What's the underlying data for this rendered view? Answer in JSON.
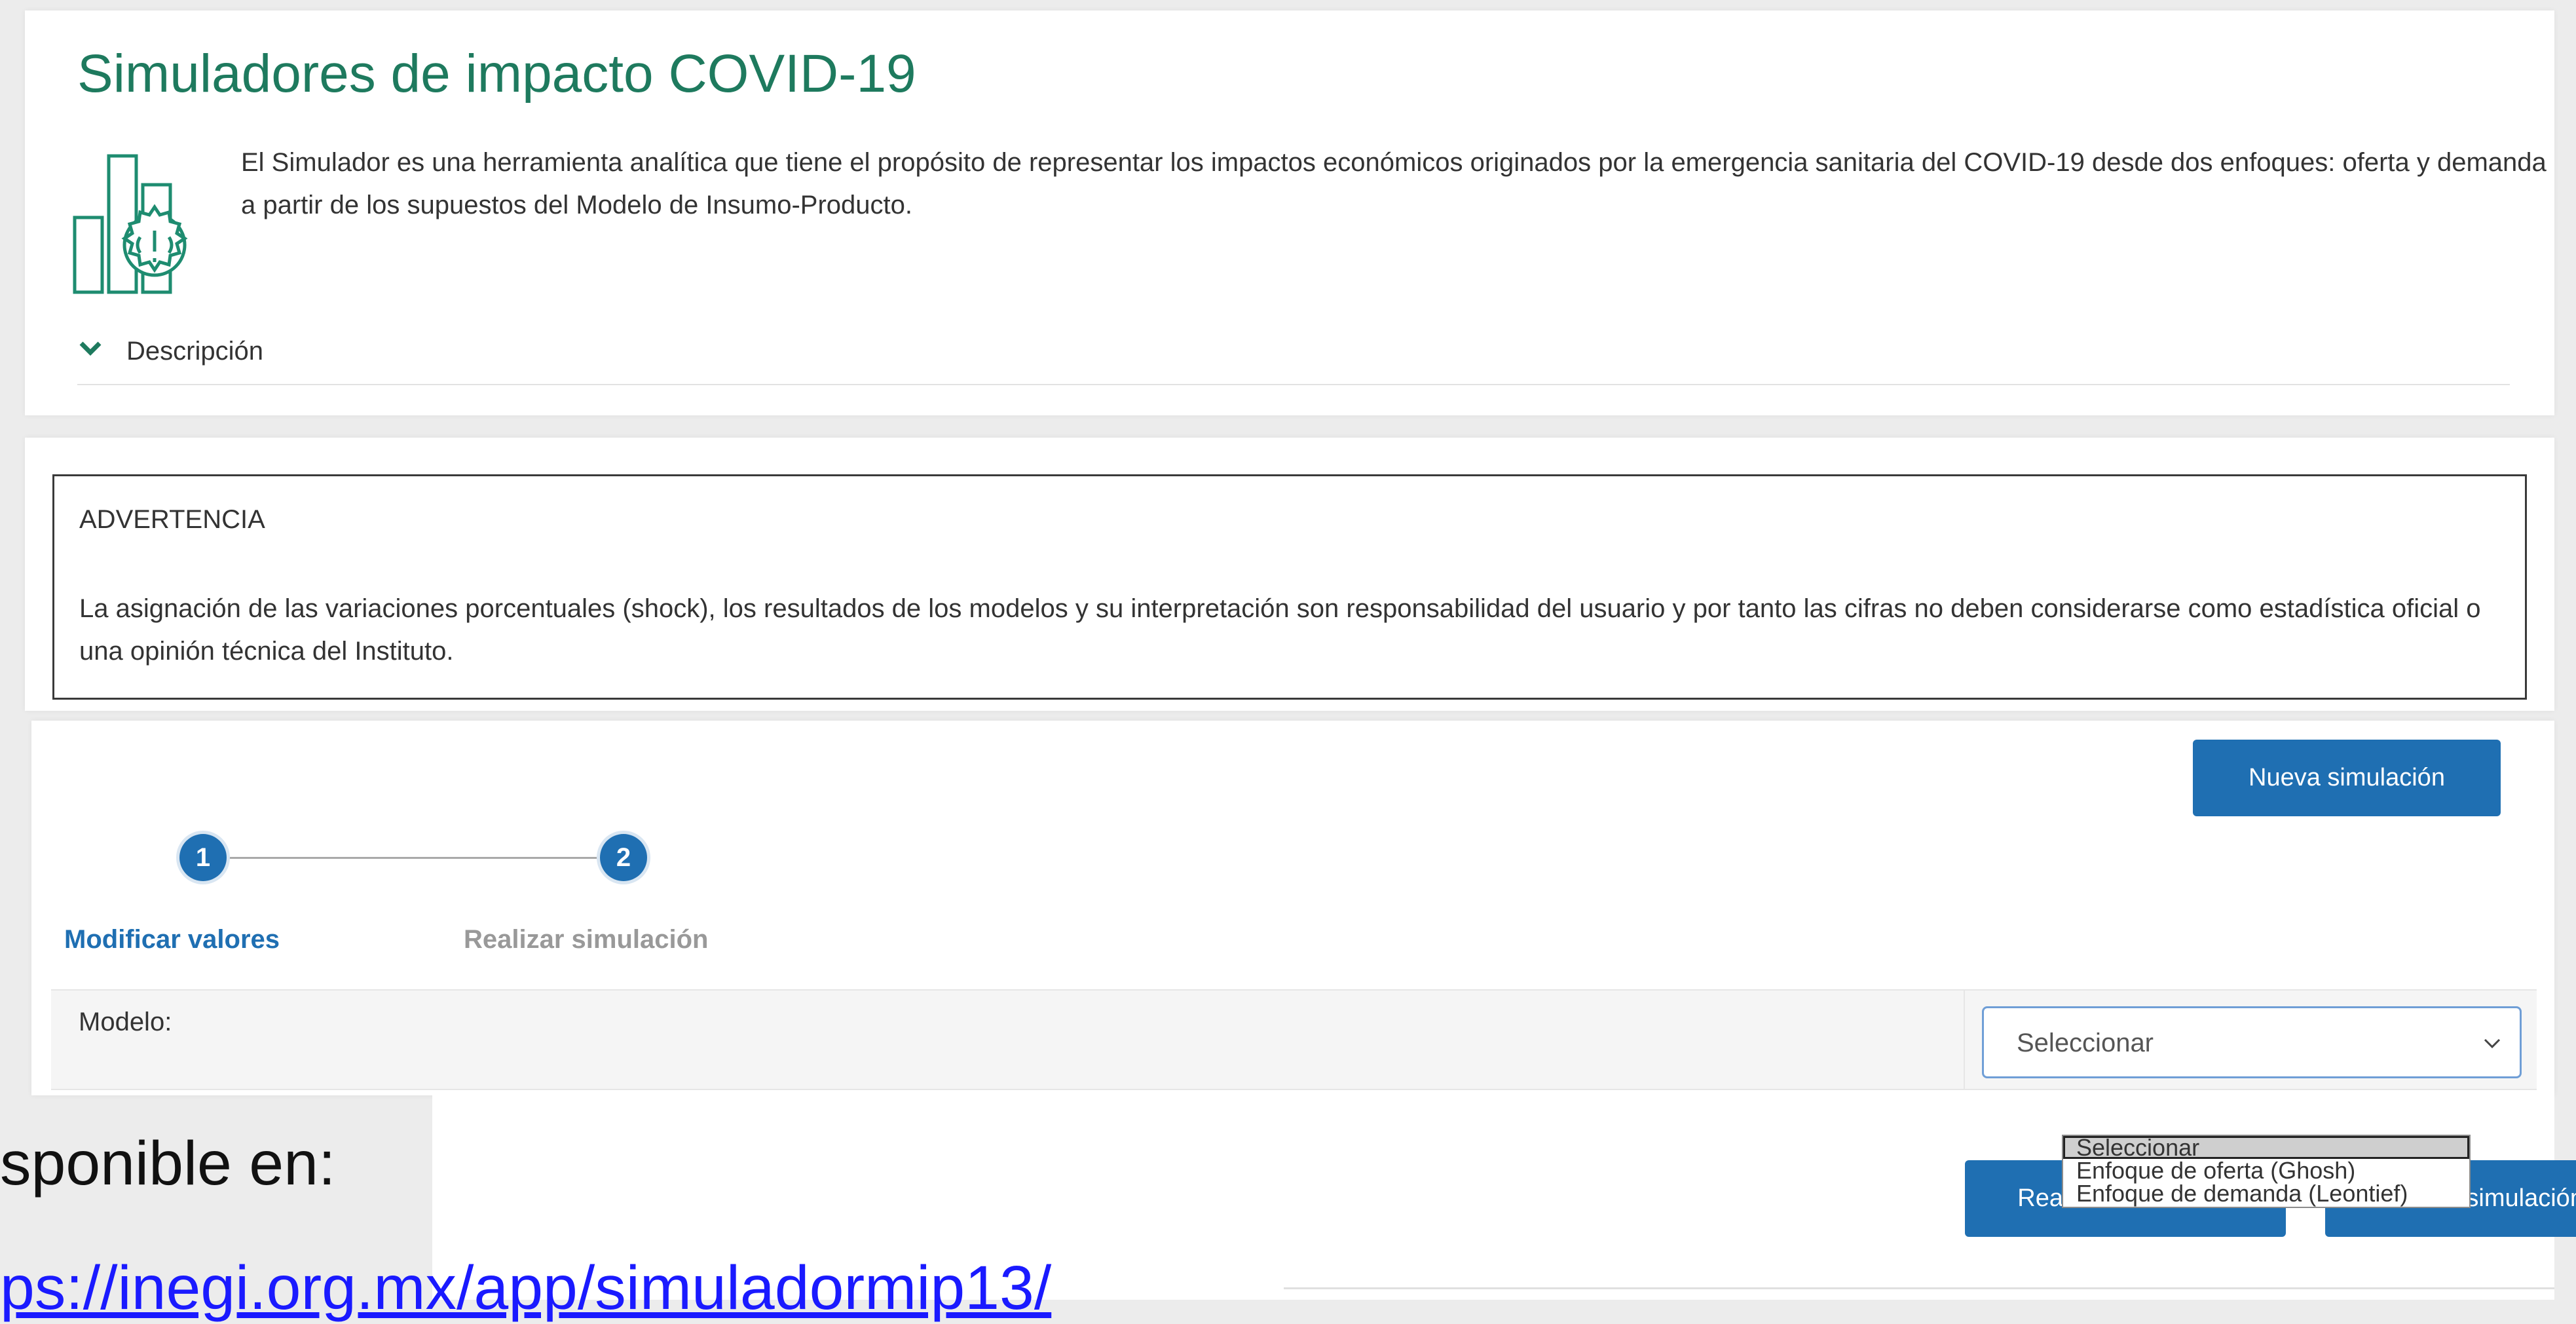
{
  "header": {
    "title": "Simuladores de impacto COVID-19",
    "intro": "El Simulador es una herramienta analítica que tiene el propósito de representar los impactos económicos originados por la emergencia sanitaria del COVID-19 desde dos enfoques: oferta y demanda a partir de los supuestos del Modelo de Insumo-Producto.",
    "description_toggle": "Descripción",
    "icon": "covid-simulator-icon",
    "accent_color": "#1e7a5e"
  },
  "warning": {
    "title": "ADVERTENCIA",
    "text": "La asignación de las variaciones porcentuales (shock), los resultados de los modelos y su interpretación son responsabilidad del usuario y por tanto las cifras no deben considerarse como estadística oficial o una opinión técnica del Instituto."
  },
  "simulation": {
    "new_simulation_label": "Nueva simulación",
    "steps": [
      {
        "number": "1",
        "label": "Modificar valores"
      },
      {
        "number": "2",
        "label": "Realizar simulación"
      }
    ],
    "model_label": "Modelo:",
    "select_value": "Seleccionar",
    "options": [
      "Seleccionar",
      "Enfoque de oferta (Ghosh)",
      "Enfoque de demanda (Leontief)"
    ],
    "run_label": "Realizar simulación",
    "new_simulation_bottom_label": "Nueva simulación",
    "button_color": "#1f6fb2"
  },
  "overlay": {
    "line1": "sponible en:",
    "line2": "ps://inegi.org.mx/app/simuladormip13/"
  }
}
